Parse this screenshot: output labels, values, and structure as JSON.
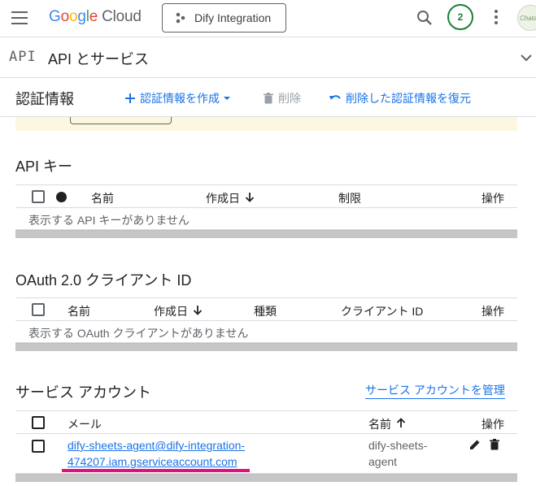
{
  "header": {
    "logo_google": [
      "G",
      "o",
      "o",
      "g",
      "l",
      "e"
    ],
    "logo_cloud": "Cloud",
    "project_name": "Dify Integration",
    "notification_count": "2",
    "avatar_text": "Chata"
  },
  "product": {
    "icon_text": "API",
    "title": "API とサービス"
  },
  "actions": {
    "page_title": "認証情報",
    "create_label": "認証情報を作成",
    "delete_label": "削除",
    "restore_label": "削除した認証情報を復元"
  },
  "api_keys": {
    "title": "API キー",
    "columns": [
      "名前",
      "作成日",
      "制限",
      "操作"
    ],
    "empty_text": "表示する API キーがありません"
  },
  "oauth": {
    "title": "OAuth 2.0 クライアント ID",
    "columns": [
      "名前",
      "作成日",
      "種類",
      "クライアント ID",
      "操作"
    ],
    "empty_text": "表示する OAuth クライアントがありません"
  },
  "service_accounts": {
    "title": "サービス アカウント",
    "manage_link": "サービス アカウントを管理",
    "columns": [
      "メール",
      "名前",
      "操作"
    ],
    "rows": [
      {
        "email_line1": "dify-sheets-agent@dify-integration-",
        "email_line2": "474207.iam.gserviceaccount.com",
        "name_line1": "dify-sheets-",
        "name_line2": "agent"
      }
    ]
  },
  "colors": {
    "accent": "#1a73e8",
    "highlight": "#e0107a",
    "banner": "#fef7e0",
    "badge": "#188038"
  }
}
